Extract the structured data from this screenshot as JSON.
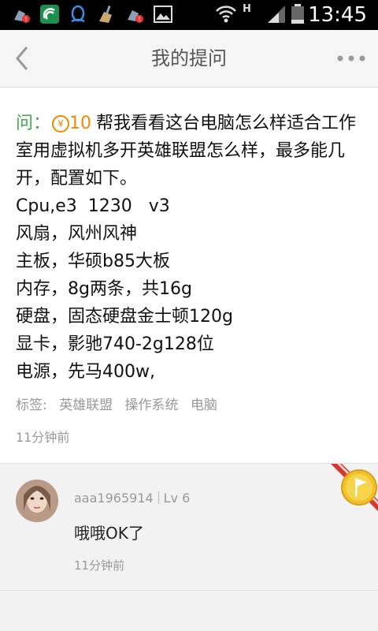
{
  "status_bar": {
    "time": "13:45",
    "network": "H"
  },
  "header": {
    "title": "我的提问"
  },
  "question": {
    "prefix": "问：",
    "reward": "10",
    "body": "帮我看看这台电脑怎么样适合工作室用虚拟机多开英雄联盟怎么样，最多能几开，配置如下。\nCpu,e3  1230   v3\n风扇，风州风神\n主板，华硕b85大板\n内存，8g两条，共16g\n硬盘，固态硬盘金士顿120g\n显卡，影驰740-2g128位\n电源，先马400w,",
    "tags_label": "标签:",
    "tags": [
      "英雄联盟",
      "操作系统",
      "电脑"
    ],
    "time": "11分钟前"
  },
  "answer": {
    "username": "aaa1965914",
    "level": "Lv 6",
    "text": "哦哦OK了",
    "time": "11分钟前"
  },
  "colors": {
    "accent_green": "#3fa84f",
    "reward_orange": "#f08a00",
    "ribbon_red": "#d9362b",
    "ribbon_gold": "#f2c12e"
  }
}
